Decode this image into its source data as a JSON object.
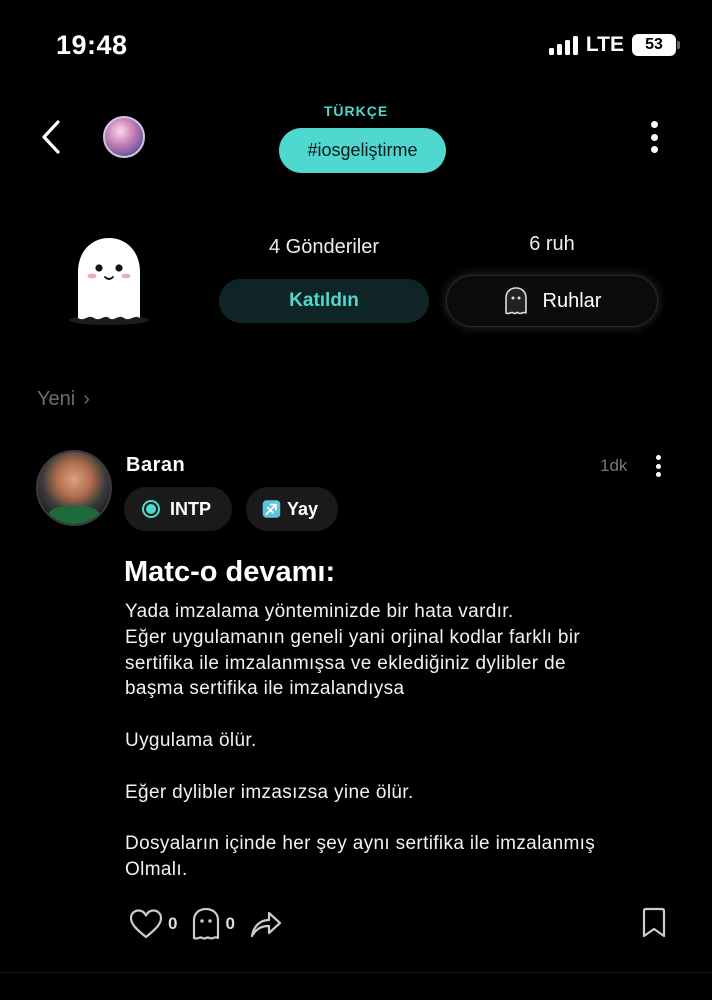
{
  "status_bar": {
    "time": "19:48",
    "network": "LTE",
    "battery": "53"
  },
  "header": {
    "language": "TÜRKÇE",
    "hashtag": "#iosgeliştirme"
  },
  "stats": {
    "posts": "4 Gönderiler",
    "souls": "6 ruh",
    "joined_label": "Katıldın",
    "souls_button_label": "Ruhlar"
  },
  "section": {
    "label": "Yeni",
    "chevron": "›"
  },
  "post": {
    "author": "Baran",
    "time": "1dk",
    "tags": {
      "mbti": "INTP",
      "zodiac": "Yay"
    },
    "title": "Matc-o devamı:",
    "body": [
      "Yada imzalama yönteminizde bir hata vardır.",
      "Eğer uygulamanın geneli yani orjinal kodlar farklı bir",
      "sertifika ile imzalanmışsa ve eklediğiniz dylibler de",
      "başma sertifika ile imzalandıysa",
      "",
      "Uygulama ölür.",
      "",
      "Eğer dylibler imzasızsa yine ölür.",
      "",
      "Dosyaların içinde her şey aynı sertifika ile imzalanmış",
      "Olmalı."
    ],
    "likes": "0",
    "ghost_reactions": "0"
  },
  "icons": {
    "back": "chevron-left-icon",
    "more": "more-vertical-icon",
    "ghost": "ghost-icon",
    "heart": "heart-icon",
    "share": "share-icon",
    "bookmark": "bookmark-icon",
    "zodiac": "sagittarius-icon"
  },
  "colors": {
    "accent": "#4fd8cf",
    "background": "#000000",
    "chip": "#1a1a1a"
  }
}
